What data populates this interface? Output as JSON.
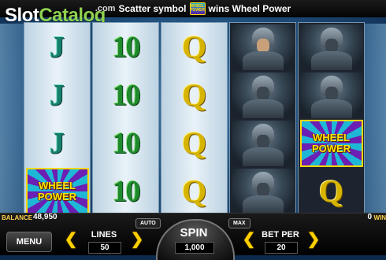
{
  "top_message": {
    "prefix": ".com",
    "text_before": "Scatter symbol",
    "text_after": "wins Wheel Power",
    "icon": "wheel-power-mini-icon"
  },
  "watermark": {
    "part_a": "Slot",
    "part_b": "Catalog"
  },
  "reels": [
    [
      "J",
      "J",
      "J",
      "WHEEL POWER"
    ],
    [
      "10",
      "10",
      "10",
      "10"
    ],
    [
      "Q",
      "Q",
      "Q",
      "Q"
    ],
    [
      "warrior",
      "knight",
      "knight",
      "knight"
    ],
    [
      "knight",
      "knight",
      "WHEEL POWER",
      "Q"
    ]
  ],
  "wheel_symbol": {
    "line1": "WHEEL",
    "line2": "POWER"
  },
  "console": {
    "balance_label": "BALANCE",
    "balance_value": "48,950",
    "win_value": "0",
    "win_label": "WIN",
    "menu_label": "MENU",
    "lines_label": "LINES",
    "lines_value": "50",
    "auto_label": "AUTO",
    "spin_label": "SPIN",
    "spin_value": "1,000",
    "max_label": "MAX",
    "bet_label": "BET PER",
    "bet_value": "20"
  },
  "colors": {
    "accent": "#ffd000",
    "reel_bg": "#e9f2f8"
  }
}
